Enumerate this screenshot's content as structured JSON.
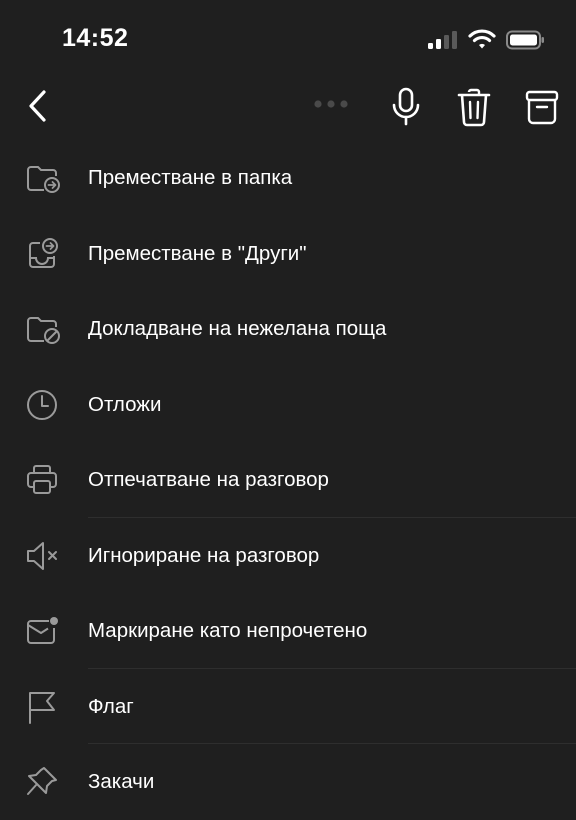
{
  "status_bar": {
    "time": "14:52",
    "icons": [
      "cellular-signal-icon",
      "wifi-icon",
      "battery-icon"
    ]
  },
  "top_bar": {
    "icons": [
      "back-icon",
      "more-icon",
      "microphone-icon",
      "trash-icon",
      "archive-icon"
    ]
  },
  "menu": {
    "items": [
      {
        "label": "Преместване в папка",
        "icon": "move-to-folder-icon"
      },
      {
        "label": "Преместване в \"Други\"",
        "icon": "move-to-other-icon"
      },
      {
        "label": "Докладване на нежелана поща",
        "icon": "report-junk-icon"
      },
      {
        "label": "Отложи",
        "icon": "clock-icon"
      },
      {
        "label": "Отпечатване на разговор",
        "icon": "printer-icon"
      },
      {
        "label": "Игнориране на разговор",
        "icon": "mute-icon"
      },
      {
        "label": "Маркиране като непрочетено",
        "icon": "mark-unread-icon"
      },
      {
        "label": "Флаг",
        "icon": "flag-icon"
      },
      {
        "label": "Закачи",
        "icon": "pin-icon"
      }
    ]
  },
  "colors": {
    "background": "#1f1f1f",
    "text": "#ffffff",
    "icon": "#9a9a9a",
    "divider": "#2e2e2e",
    "more_dots": "#4a4a4a"
  }
}
